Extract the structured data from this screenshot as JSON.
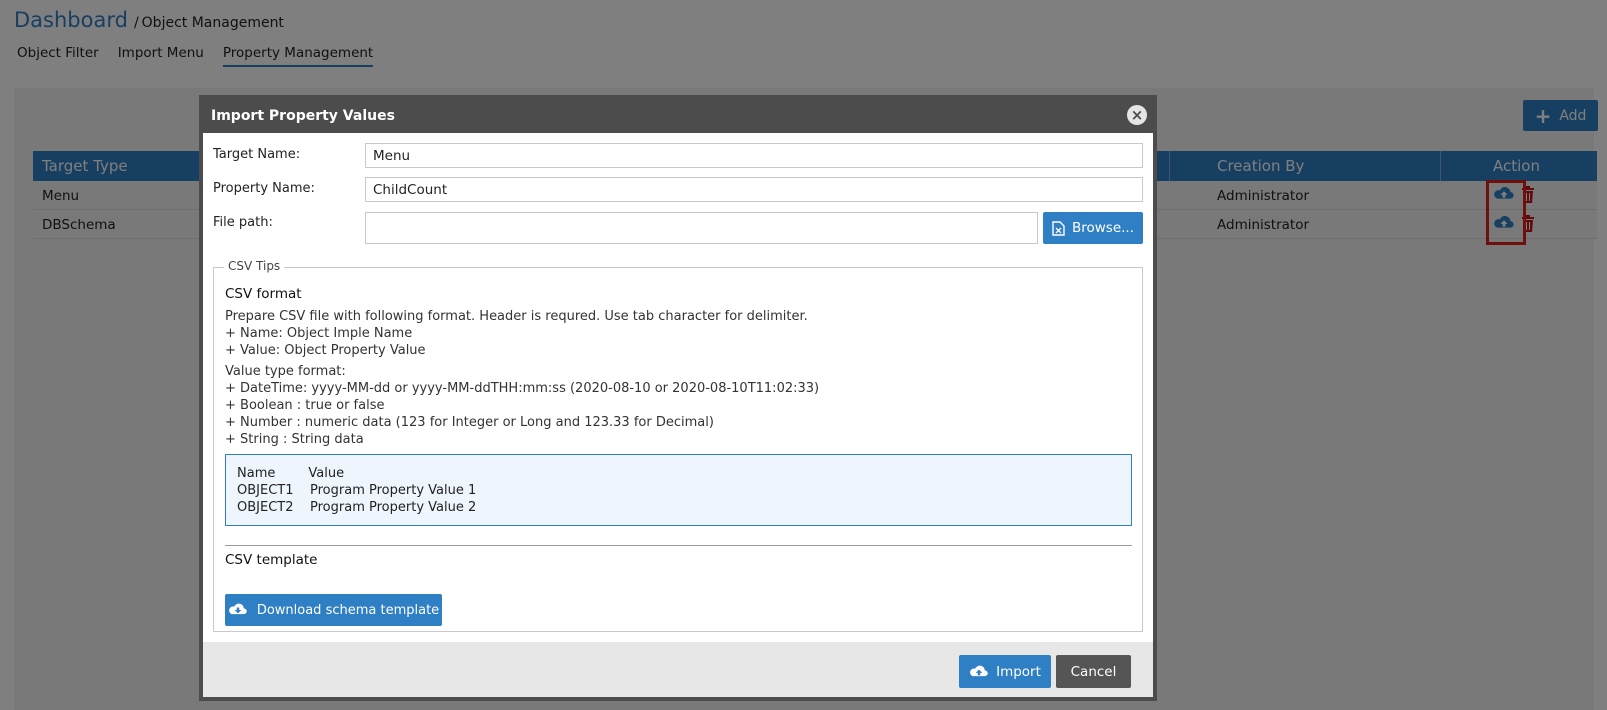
{
  "breadcrumb": {
    "root": "Dashboard",
    "separator": "/",
    "current": "Object Management"
  },
  "tabs": [
    {
      "label": "Object Filter"
    },
    {
      "label": "Import Menu"
    },
    {
      "label": "Property Management"
    }
  ],
  "active_tab": "Property Management",
  "add_button": {
    "label": "Add"
  },
  "grid": {
    "columns": [
      "Target Type",
      "Creation By",
      "Action"
    ],
    "rows": [
      {
        "target_type": "Menu",
        "creation_by": "Administrator"
      },
      {
        "target_type": "DBSchema",
        "creation_by": "Administrator"
      }
    ]
  },
  "modal": {
    "title": "Import Property Values",
    "target_name_label": "Target Name:",
    "target_name_value": "Menu",
    "property_name_label": "Property Name:",
    "property_name_value": "ChildCount",
    "file_path_label": "File path:",
    "file_path_value": "",
    "browse_label": "Browse...",
    "tips_legend": "CSV Tips",
    "csv_format_title": "CSV format",
    "csv_format_text": "Prepare CSV file with following format. Header is requred. Use tab character for delimiter.\n+ Name: Object Imple Name\n+ Value: Object Property Value",
    "value_type_text": "Value type format:\n+ DateTime: yyyy-MM-dd or yyyy-MM-ddTHH:mm:ss (2020-08-10 or 2020-08-10T11:02:33)\n+ Boolean : true or false\n+ Number : numeric data (123 for Integer or Long and 123.33 for Decimal)\n+ String : String data",
    "sample": "Name        Value\nOBJECT1    Program Property Value 1\nOBJECT2    Program Property Value 2",
    "csv_template_title": "CSV template",
    "download_label": "Download schema template",
    "import_label": "Import",
    "cancel_label": "Cancel"
  },
  "colors": {
    "accent": "#2f7fc4",
    "header_dark": "#4c4c4c",
    "delete_red": "#c0151b",
    "highlight_red": "#e0201b"
  },
  "icons": [
    "plus-icon",
    "cloud-upload-icon",
    "trash-icon",
    "close-icon",
    "file-icon",
    "cloud-download-icon"
  ]
}
